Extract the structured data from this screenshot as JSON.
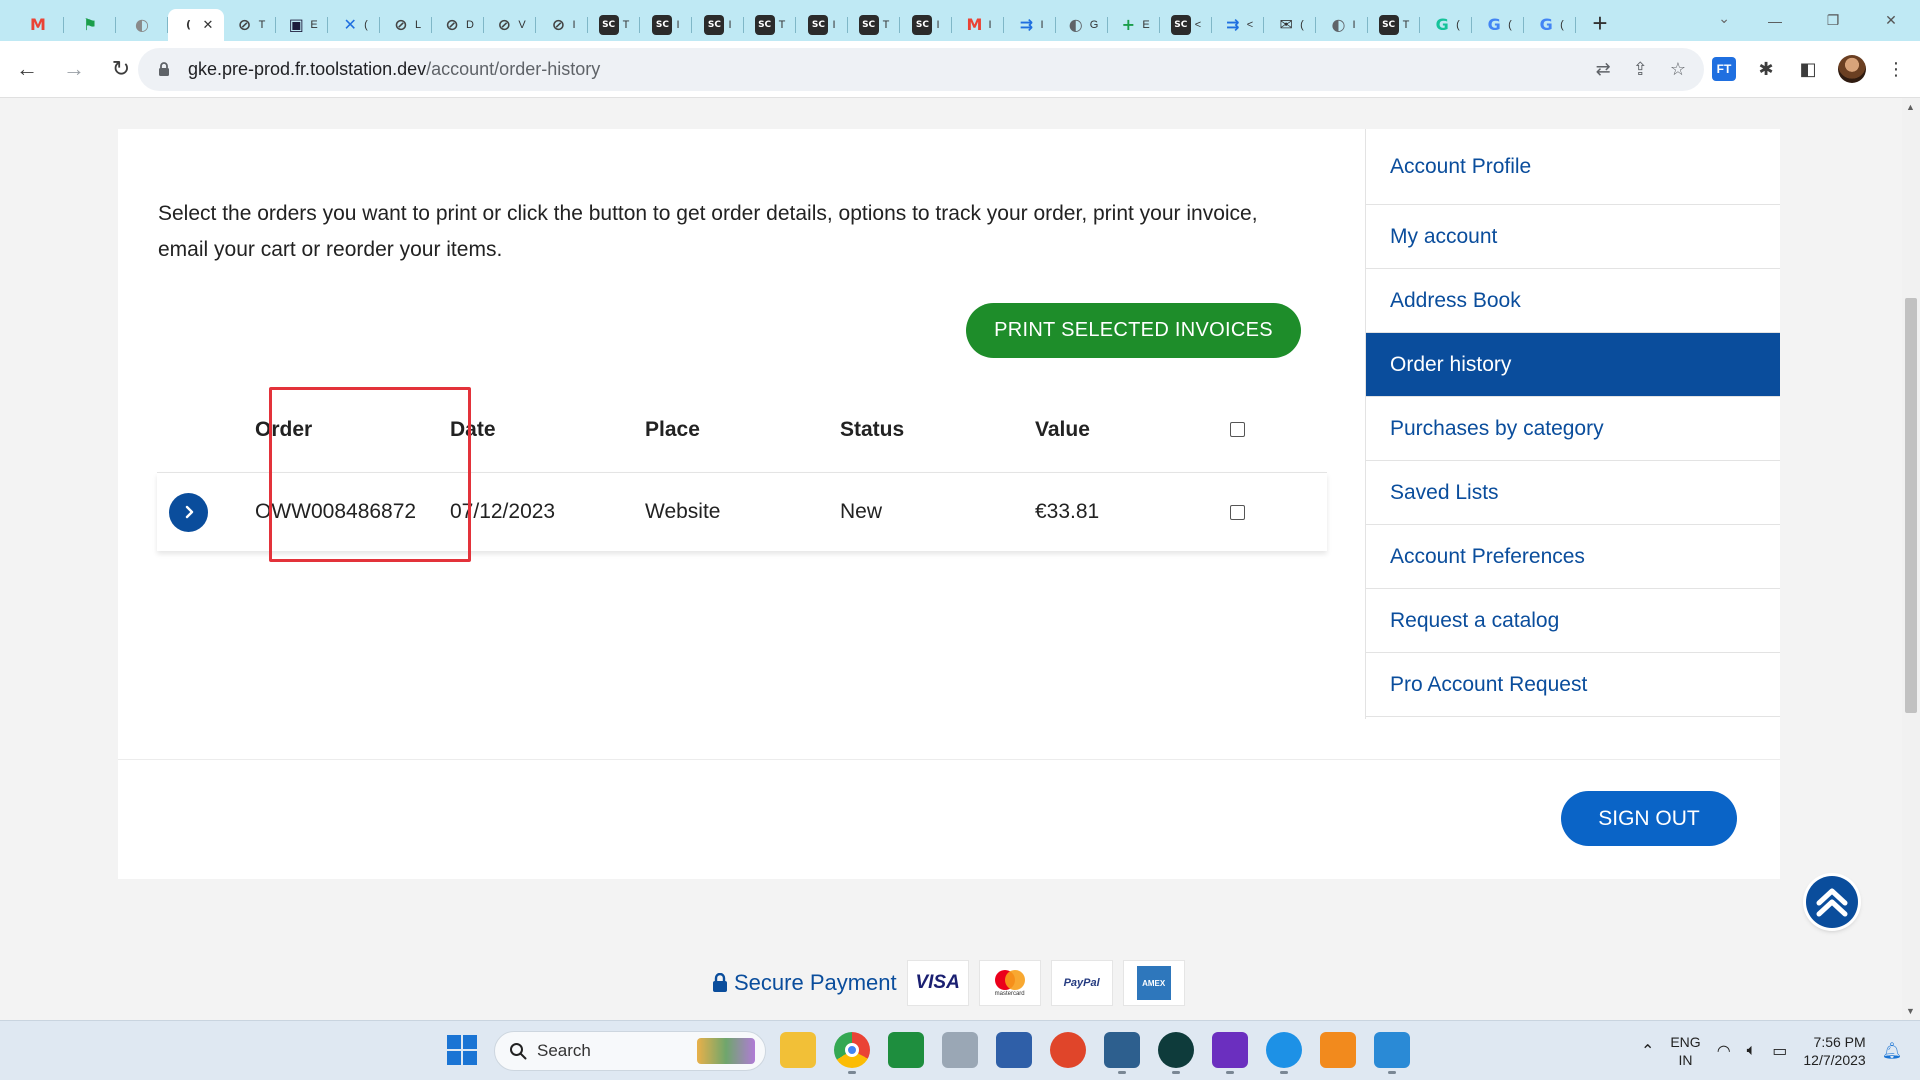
{
  "browser": {
    "tabs": [
      {
        "icon": "gmail-icon",
        "glyph": "M",
        "color": "#ea4335",
        "letter": ""
      },
      {
        "icon": "chat-flag-icon",
        "glyph": "⚑",
        "color": "#1a9e4a",
        "letter": ""
      },
      {
        "icon": "globe-icon",
        "glyph": "◐",
        "color": "#8a8a8a",
        "letter": ""
      },
      {
        "icon": "loading-icon",
        "glyph": "(",
        "color": "#ffffff",
        "letter": "",
        "active": true
      },
      {
        "icon": "link-icon",
        "glyph": "⊘",
        "color": "#444444",
        "letter": "T"
      },
      {
        "icon": "app-icon",
        "glyph": "▣",
        "color": "#1c1c3c",
        "letter": "E"
      },
      {
        "icon": "confluence-icon",
        "glyph": "✕",
        "color": "#1f6fe0",
        "letter": "("
      },
      {
        "icon": "link-icon",
        "glyph": "⊘",
        "color": "#444444",
        "letter": "L"
      },
      {
        "icon": "link-icon",
        "glyph": "⊘",
        "color": "#444444",
        "letter": "D"
      },
      {
        "icon": "link-icon",
        "glyph": "⊘",
        "color": "#444444",
        "letter": "V"
      },
      {
        "icon": "link-icon",
        "glyph": "⊘",
        "color": "#444444",
        "letter": "I"
      },
      {
        "icon": "sc-icon",
        "glyph": "SC",
        "color": "#2b2b2b",
        "letter": "T"
      },
      {
        "icon": "sc-icon",
        "glyph": "SC",
        "color": "#2b2b2b",
        "letter": "I"
      },
      {
        "icon": "sc-icon",
        "glyph": "SC",
        "color": "#2b2b2b",
        "letter": "I"
      },
      {
        "icon": "sc-icon",
        "glyph": "SC",
        "color": "#2b2b2b",
        "letter": "T"
      },
      {
        "icon": "sc-icon",
        "glyph": "SC",
        "color": "#2b2b2b",
        "letter": "I"
      },
      {
        "icon": "sc-icon",
        "glyph": "SC",
        "color": "#2b2b2b",
        "letter": "T"
      },
      {
        "icon": "sc-icon",
        "glyph": "SC",
        "color": "#2b2b2b",
        "letter": "I"
      },
      {
        "icon": "gmail-icon",
        "glyph": "M",
        "color": "#ea4335",
        "letter": "I"
      },
      {
        "icon": "jira-icon",
        "glyph": "⇉",
        "color": "#1f6fe0",
        "letter": "I"
      },
      {
        "icon": "globe-icon",
        "glyph": "◐",
        "color": "#5f6368",
        "letter": "G"
      },
      {
        "icon": "sheets-icon",
        "glyph": "+",
        "color": "#1a9e4a",
        "letter": "E"
      },
      {
        "icon": "sc-icon",
        "glyph": "SC",
        "color": "#2b2b2b",
        "letter": "<"
      },
      {
        "icon": "jira-icon",
        "glyph": "⇉",
        "color": "#1f6fe0",
        "letter": "<"
      },
      {
        "icon": "mail-icon",
        "glyph": "✉",
        "color": "#333333",
        "letter": "("
      },
      {
        "icon": "globe-icon",
        "glyph": "◐",
        "color": "#5f6368",
        "letter": "I"
      },
      {
        "icon": "sc-icon",
        "glyph": "SC",
        "color": "#2b2b2b",
        "letter": "T"
      },
      {
        "icon": "grammarly-icon",
        "glyph": "G",
        "color": "#15c39a",
        "letter": "("
      },
      {
        "icon": "google-icon",
        "glyph": "G",
        "color": "#4285f4",
        "letter": "("
      },
      {
        "icon": "google-icon",
        "glyph": "G",
        "color": "#4285f4",
        "letter": "("
      }
    ],
    "new_tab": "+",
    "url_host": "gke.pre-prod.fr.toolstation.dev",
    "url_path": "/account/order-history"
  },
  "page": {
    "intro": "Select the orders you want to print or click the button to get order details, options to track your order, print your invoice, email your cart or reorder your items.",
    "print_button": "PRINT SELECTED INVOICES",
    "table": {
      "headers": {
        "order": "Order",
        "date": "Date",
        "place": "Place",
        "status": "Status",
        "value": "Value"
      },
      "rows": [
        {
          "order": "OWW008486872",
          "date": "07/12/2023",
          "place": "Website",
          "status": "New",
          "value": "€33.81"
        }
      ]
    },
    "sidebar": {
      "items": [
        {
          "label": "Account Profile"
        },
        {
          "label": "My account"
        },
        {
          "label": "Address Book"
        },
        {
          "label": "Order history",
          "active": true
        },
        {
          "label": "Purchases by category"
        },
        {
          "label": "Saved Lists"
        },
        {
          "label": "Account Preferences"
        },
        {
          "label": "Request a catalog"
        },
        {
          "label": "Pro Account Request"
        }
      ]
    },
    "sign_out": "SIGN OUT",
    "secure_payment": "Secure Payment",
    "payment_methods": [
      "VISA",
      "mastercard",
      "PayPal",
      "AMEX"
    ]
  },
  "taskbar": {
    "search_placeholder": "Search",
    "lang": "ENG",
    "region": "IN",
    "time": "7:56 PM",
    "date": "12/7/2023"
  },
  "colors": {
    "brand_blue": "#0a4d9c",
    "print_green": "#1e8d2a",
    "highlight_red": "#e3323a",
    "signout_blue": "#0a64c7"
  }
}
